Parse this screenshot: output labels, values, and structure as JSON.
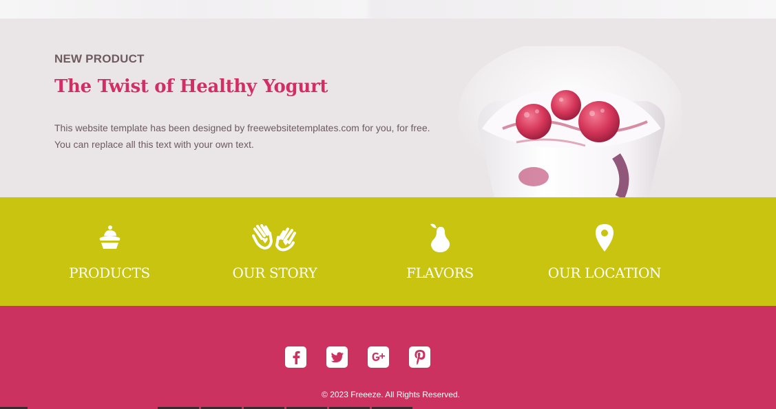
{
  "hero": {
    "eyebrow": "NEW PRODUCT",
    "title": "The Twist of Healthy Yogurt",
    "description_line1": "This website template has been designed by freewebsitetemplates.com for you, for free.",
    "description_line2": "You can replace all this text with your own text."
  },
  "nav": {
    "items": [
      {
        "label": "PRODUCTS",
        "icon": "cupcake-icon"
      },
      {
        "label": "OUR STORY",
        "icon": "hands-icon"
      },
      {
        "label": "FLAVORS",
        "icon": "pear-icon"
      },
      {
        "label": "OUR LOCATION",
        "icon": "map-pin-icon"
      }
    ]
  },
  "footer": {
    "social": [
      "facebook-icon",
      "twitter-icon",
      "google-plus-icon",
      "pinterest-icon"
    ],
    "copyright": "© 2023 Freeeze. All Rights Reserved."
  },
  "colors": {
    "hero_bg": "#eae6e8",
    "accent_pink": "#d22e64",
    "band_olive": "#c8c40f",
    "footer_pink": "#cc3260"
  }
}
